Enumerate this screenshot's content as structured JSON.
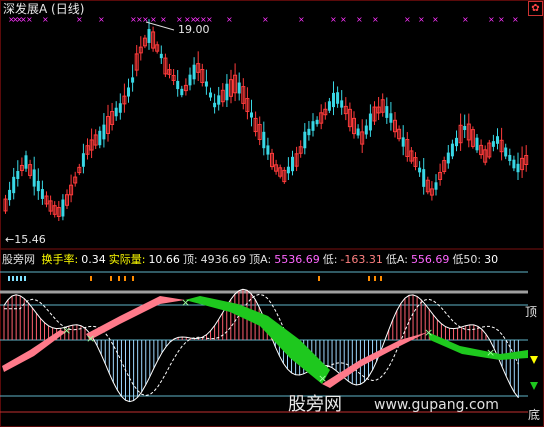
{
  "header": {
    "stock_title": "深发展A (日线)",
    "settings_icon": "gear-icon"
  },
  "price_chart": {
    "high_label": "19.00",
    "low_label": "←15.46"
  },
  "indicator_bar": {
    "site_name": "股旁网",
    "items": [
      {
        "label": "换手率:",
        "value": "0.34",
        "color": "#ffffff",
        "label_color": "#ffff00"
      },
      {
        "label": "实际量:",
        "value": "10.66",
        "color": "#ffffff",
        "label_color": "#ffff00"
      },
      {
        "label": "顶:",
        "value": "4936.69",
        "color": "#e0e0e0",
        "label_color": "#e0e0e0"
      },
      {
        "label": "顶A:",
        "value": "5536.69",
        "color": "#ff66ff",
        "label_color": "#e0e0e0"
      },
      {
        "label": "低:",
        "value": "-163.31",
        "color": "#ff8080",
        "label_color": "#e0e0e0"
      },
      {
        "label": "低A:",
        "value": "556.69",
        "color": "#ff66ff",
        "label_color": "#e0e0e0"
      },
      {
        "label": "低50:",
        "value": "30",
        "color": "#ffffff",
        "label_color": "#e0e0e0"
      }
    ]
  },
  "right_labels": {
    "top": "顶",
    "bottom": "底"
  },
  "watermark": {
    "cn": "股旁网",
    "url": "www.gupang.com"
  },
  "colors": {
    "background": "#000000",
    "up_candle": "#ff3b3b",
    "down_candle": "#39d7e5",
    "marker": "#ff33ff",
    "green_band": "#1ec81e",
    "pink_band": "#ff7a8a"
  }
}
